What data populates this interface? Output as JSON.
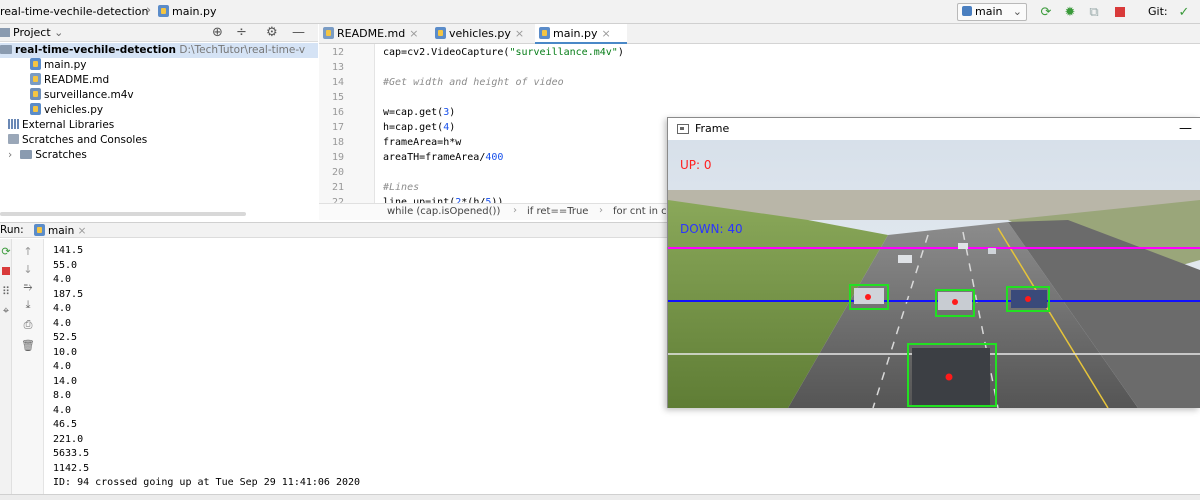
{
  "navbar": {
    "project_crumb": "real-time-vechile-detection",
    "file_crumb": "main.py",
    "run_config": "main",
    "git_label": "Git:"
  },
  "project_panel": {
    "title": "Project",
    "root": {
      "name": "real-time-vechile-detection",
      "path": "D:\\TechTutor\\real-time-v"
    },
    "files": [
      "main.py",
      "README.md",
      "surveillance.m4v",
      "vehicles.py"
    ],
    "external_libraries": "External Libraries",
    "scratches_consoles": "Scratches and Consoles",
    "scratches": "Scratches"
  },
  "editor": {
    "tabs": [
      {
        "label": "README.md",
        "active": false
      },
      {
        "label": "vehicles.py",
        "active": false
      },
      {
        "label": "main.py",
        "active": true
      }
    ],
    "line_numbers": [
      "12",
      "13",
      "14",
      "15",
      "16",
      "17",
      "18",
      "19",
      "20",
      "21",
      "22"
    ],
    "code_lines": [
      "cap=cv2.VideoCapture(\"surveillance.m4v\")",
      "",
      "#Get width and height of video",
      "",
      "w=cap.get(3)",
      "h=cap.get(4)",
      "frameArea=h*w",
      "areaTH=frameArea/400",
      "",
      "#Lines",
      "line_up=int(2*(h/5))"
    ],
    "breadcrumbs": [
      "while (cap.isOpened())",
      "if ret==True",
      "for cnt in c"
    ]
  },
  "run_panel": {
    "label": "Run:",
    "tab_label": "main",
    "output": [
      "141.5",
      "55.0",
      "4.0",
      "187.5",
      "4.0",
      "4.0",
      "52.5",
      "10.0",
      "4.0",
      "14.0",
      "8.0",
      "4.0",
      "46.5",
      "221.0",
      "5633.5",
      "1142.5",
      "ID: 94 crossed going up at Tue Sep 29 11:41:06 2020"
    ]
  },
  "frame_window": {
    "title": "Frame",
    "up_label": "UP: 0",
    "down_label": "DOWN: 40",
    "up_color": "#ff2020",
    "down_color": "#2b34ff",
    "line_colors": {
      "top": "#ff00ff",
      "middle": "#1010ff",
      "bottom": "#e8e8e8"
    },
    "box_color": "#22e022"
  },
  "colors": {
    "accent": "#4a88c7",
    "string": "#067d17",
    "number": "#1750eb",
    "comment": "#8c8c8c"
  }
}
